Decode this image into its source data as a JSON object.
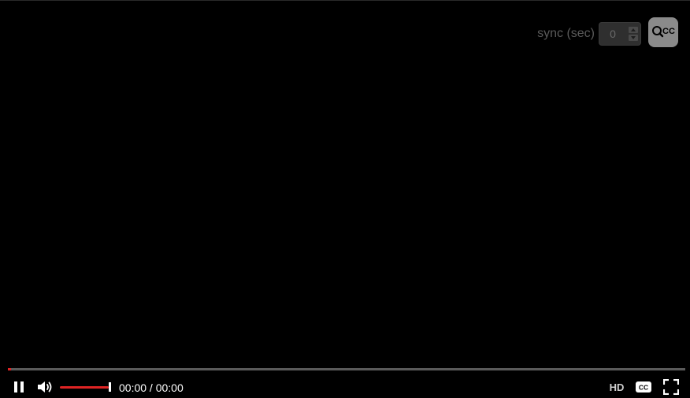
{
  "sync": {
    "label": "sync (sec)",
    "value": "0"
  },
  "search_cc": {
    "icon": "search-captions-icon",
    "text": "CC"
  },
  "progress": {
    "played_fraction": 0.005
  },
  "controls": {
    "play_state_icon": "pause-icon",
    "volume_icon": "volume-icon",
    "volume_level": 1.0,
    "time": "00:00 / 00:00",
    "hd_label": "HD",
    "cc_label": "CC",
    "fullscreen_icon": "fullscreen-icon"
  },
  "colors": {
    "accent": "#e02424",
    "background": "#000000"
  }
}
